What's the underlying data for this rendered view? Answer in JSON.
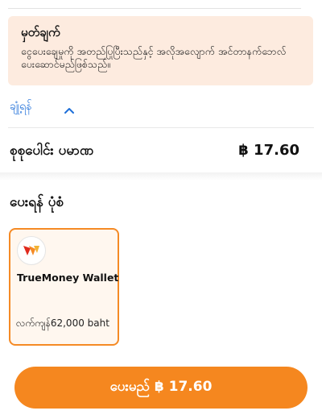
{
  "note": {
    "title": "မှတ်ချက်",
    "body": "ငွေပေးချေမှုကို အတည်ပြုပြီးသည်နှင့် အလိုအလျောက် အင်တာနက်ဘေလ် ပေးဆောင်မည်ဖြစ်သည်။"
  },
  "summary": {
    "toggle_label": "ချုံ့ရန်",
    "toggle_icon": "chevron-up-icon",
    "total_label": "စုစုပေါင်း ပမာဏ",
    "total_amount": "฿ 17.60"
  },
  "payment": {
    "heading": "ပေးရန် ပုံစံ",
    "methods": [
      {
        "name": "TrueMoney Wallet",
        "balance": "လက်ကျန်62,000 baht",
        "icon": "truemoney-logo-icon",
        "selected": true
      }
    ]
  },
  "pay_button": {
    "label": "ပေးမည် ฿ 17.60"
  },
  "colors": {
    "accent": "#f5871f",
    "note_background": "#fdebdf",
    "link": "#1e6fd9"
  }
}
